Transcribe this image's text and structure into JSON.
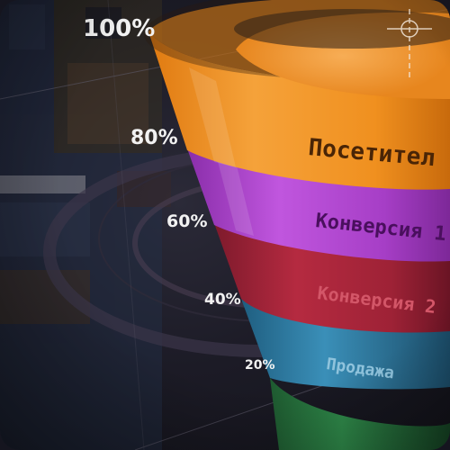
{
  "diagram": {
    "percent_labels": [
      "100%",
      "80%",
      "60%",
      "40%",
      "20%"
    ],
    "stages": [
      {
        "label": "Посетител",
        "color": "#f08a1c"
      },
      {
        "label": "Конверсия 1",
        "color": "#a53bc4"
      },
      {
        "label": "Конверсия 2",
        "color": "#a8243a"
      },
      {
        "label": "Продажа",
        "color": "#2f7fa8"
      },
      {
        "label": "",
        "color": "#2e8a4a"
      }
    ]
  },
  "background": {
    "ui_text": "...."
  }
}
